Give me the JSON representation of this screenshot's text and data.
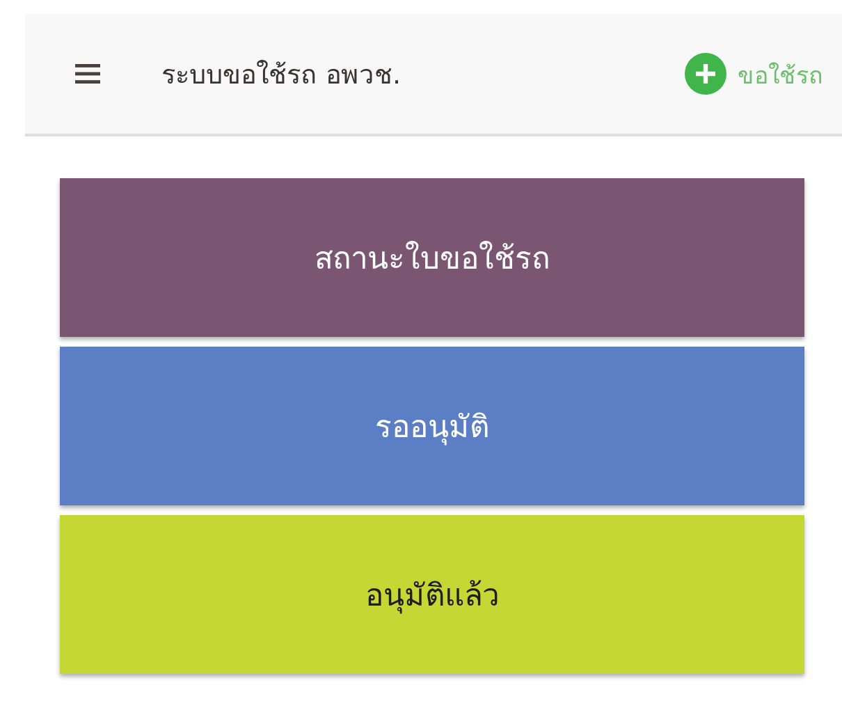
{
  "app_bar": {
    "title": "ระบบขอใช้รถ อพวช.",
    "action": "ขอใช้รถ"
  },
  "tiles": [
    {
      "label": "สถานะใบขอใช้รถ",
      "color": "#7b5672"
    },
    {
      "label": "รออนุมัติ",
      "color": "#5b7ec4"
    },
    {
      "label": "อนุมัติแล้ว",
      "color": "#c5d734"
    }
  ]
}
